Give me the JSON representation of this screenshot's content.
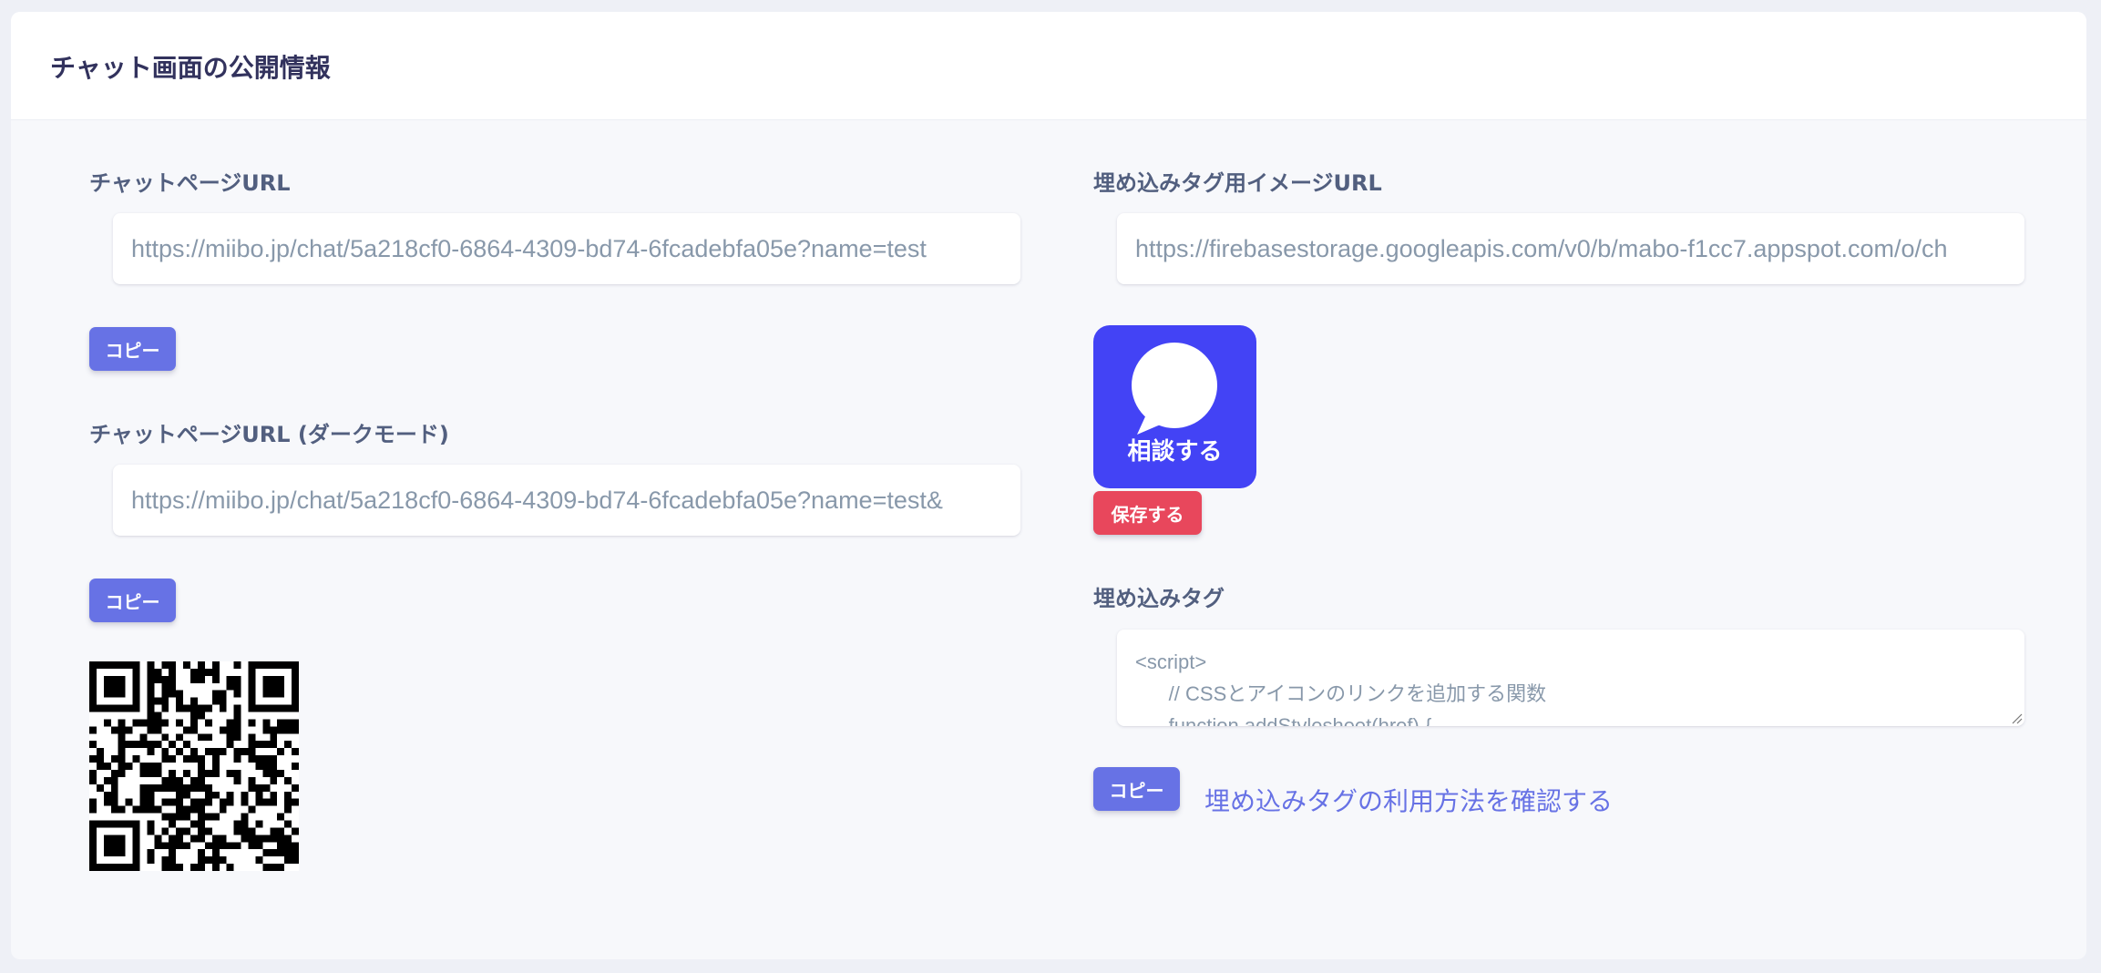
{
  "header": {
    "title": "チャット画面の公開情報"
  },
  "left": {
    "chat_url": {
      "label": "チャットページURL",
      "value": "https://miibo.jp/chat/5a218cf0-6864-4309-bd74-6fcadebfa05e?name=test"
    },
    "copy_button_label": "コピー",
    "dark_url": {
      "label": "チャットページURL (ダークモード)",
      "value": "https://miibo.jp/chat/5a218cf0-6864-4309-bd74-6fcadebfa05e?name=test&"
    },
    "copy_button_label_2": "コピー"
  },
  "right": {
    "image_url": {
      "label": "埋め込みタグ用イメージURL",
      "value": "https://firebasestorage.googleapis.com/v0/b/mabo-f1cc7.appspot.com/o/ch"
    },
    "chat_icon_text": "相談する",
    "save_button_label": "保存する",
    "embed_tag": {
      "label": "埋め込みタグ",
      "code": "<script>\n      // CSSとアイコンのリンクを追加する関数\n      function addStylesheet(href) {"
    },
    "copy_button_label": "コピー",
    "help_link": "埋め込みタグの利用方法を確認する"
  },
  "colors": {
    "primary": "#6772e5",
    "danger": "#e8475c",
    "icon_tile": "#4343f5"
  }
}
